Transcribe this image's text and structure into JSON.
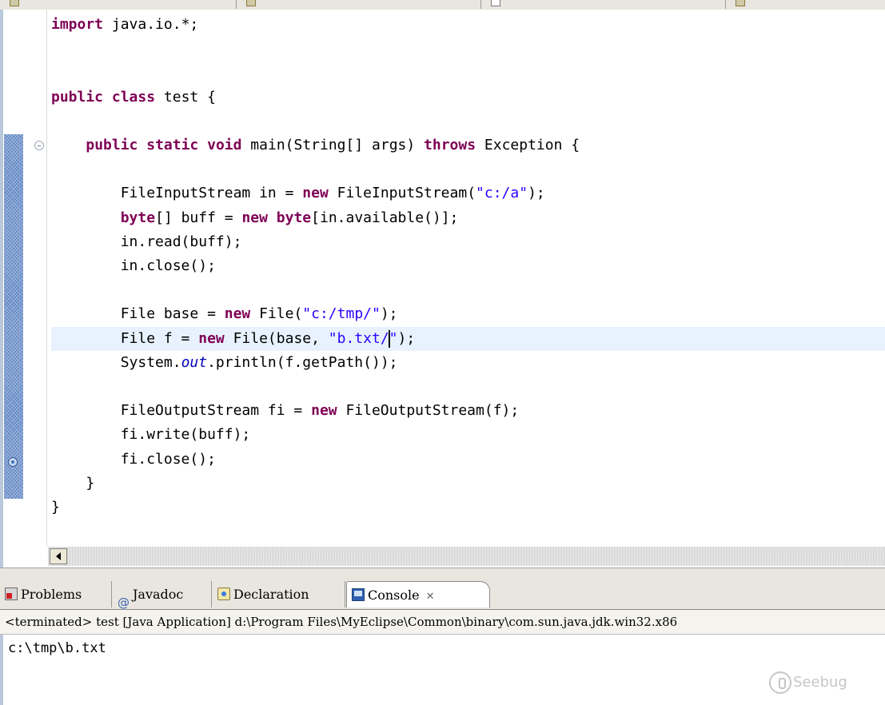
{
  "editor": {
    "code_lines": [
      [
        {
          "t": "import",
          "c": "kw"
        },
        {
          "t": " java.io.*;"
        }
      ],
      [],
      [],
      [
        {
          "t": "public",
          "c": "kw"
        },
        {
          "t": " "
        },
        {
          "t": "class",
          "c": "kw"
        },
        {
          "t": " test {"
        }
      ],
      [],
      [
        {
          "t": "    "
        },
        {
          "t": "public",
          "c": "kw"
        },
        {
          "t": " "
        },
        {
          "t": "static",
          "c": "kw"
        },
        {
          "t": " "
        },
        {
          "t": "void",
          "c": "kw"
        },
        {
          "t": " main(String[] args) "
        },
        {
          "t": "throws",
          "c": "kw"
        },
        {
          "t": " Exception {"
        }
      ],
      [],
      [
        {
          "t": "        FileInputStream in = "
        },
        {
          "t": "new",
          "c": "kw"
        },
        {
          "t": " FileInputStream("
        },
        {
          "t": "\"c:/a\"",
          "c": "str"
        },
        {
          "t": ");"
        }
      ],
      [
        {
          "t": "        "
        },
        {
          "t": "byte",
          "c": "kw"
        },
        {
          "t": "[] buff = "
        },
        {
          "t": "new",
          "c": "kw"
        },
        {
          "t": " "
        },
        {
          "t": "byte",
          "c": "kw"
        },
        {
          "t": "[in.available()];"
        }
      ],
      [
        {
          "t": "        in.read(buff);"
        }
      ],
      [
        {
          "t": "        in.close();"
        }
      ],
      [],
      [
        {
          "t": "        File base = "
        },
        {
          "t": "new",
          "c": "kw"
        },
        {
          "t": " File("
        },
        {
          "t": "\"c:/tmp/\"",
          "c": "str"
        },
        {
          "t": ");"
        }
      ],
      [
        {
          "t": "        File f = "
        },
        {
          "t": "new",
          "c": "kw"
        },
        {
          "t": " File(base, "
        },
        {
          "t": "\"b.txt/",
          "c": "str"
        },
        {
          "caret": true
        },
        {
          "t": "\"",
          "c": "str"
        },
        {
          "t": ");"
        }
      ],
      [
        {
          "t": "        System."
        },
        {
          "t": "out",
          "c": "fld"
        },
        {
          "t": ".println(f.getPath());"
        }
      ],
      [],
      [
        {
          "t": "        FileOutputStream fi = "
        },
        {
          "t": "new",
          "c": "kw"
        },
        {
          "t": " FileOutputStream(f);"
        }
      ],
      [
        {
          "t": "        fi.write(buff);"
        }
      ],
      [
        {
          "t": "        fi.close();"
        }
      ],
      [
        {
          "t": "    }"
        }
      ],
      [
        {
          "t": "}"
        }
      ]
    ],
    "current_line": 13
  },
  "views": {
    "tabs": [
      {
        "label": "Problems",
        "icon": "problems-icon"
      },
      {
        "label": "Javadoc",
        "icon": "javadoc-icon"
      },
      {
        "label": "Declaration",
        "icon": "declaration-icon"
      },
      {
        "label": "Console",
        "icon": "console-icon",
        "active": true
      }
    ],
    "close_glyph": "✕"
  },
  "console": {
    "header": "<terminated> test [Java Application] d:\\Program Files\\MyEclipse\\Common\\binary\\com.sun.java.jdk.win32.x86",
    "output": "c:\\tmp\\b.txt"
  },
  "watermark": {
    "text": "Seebug"
  }
}
